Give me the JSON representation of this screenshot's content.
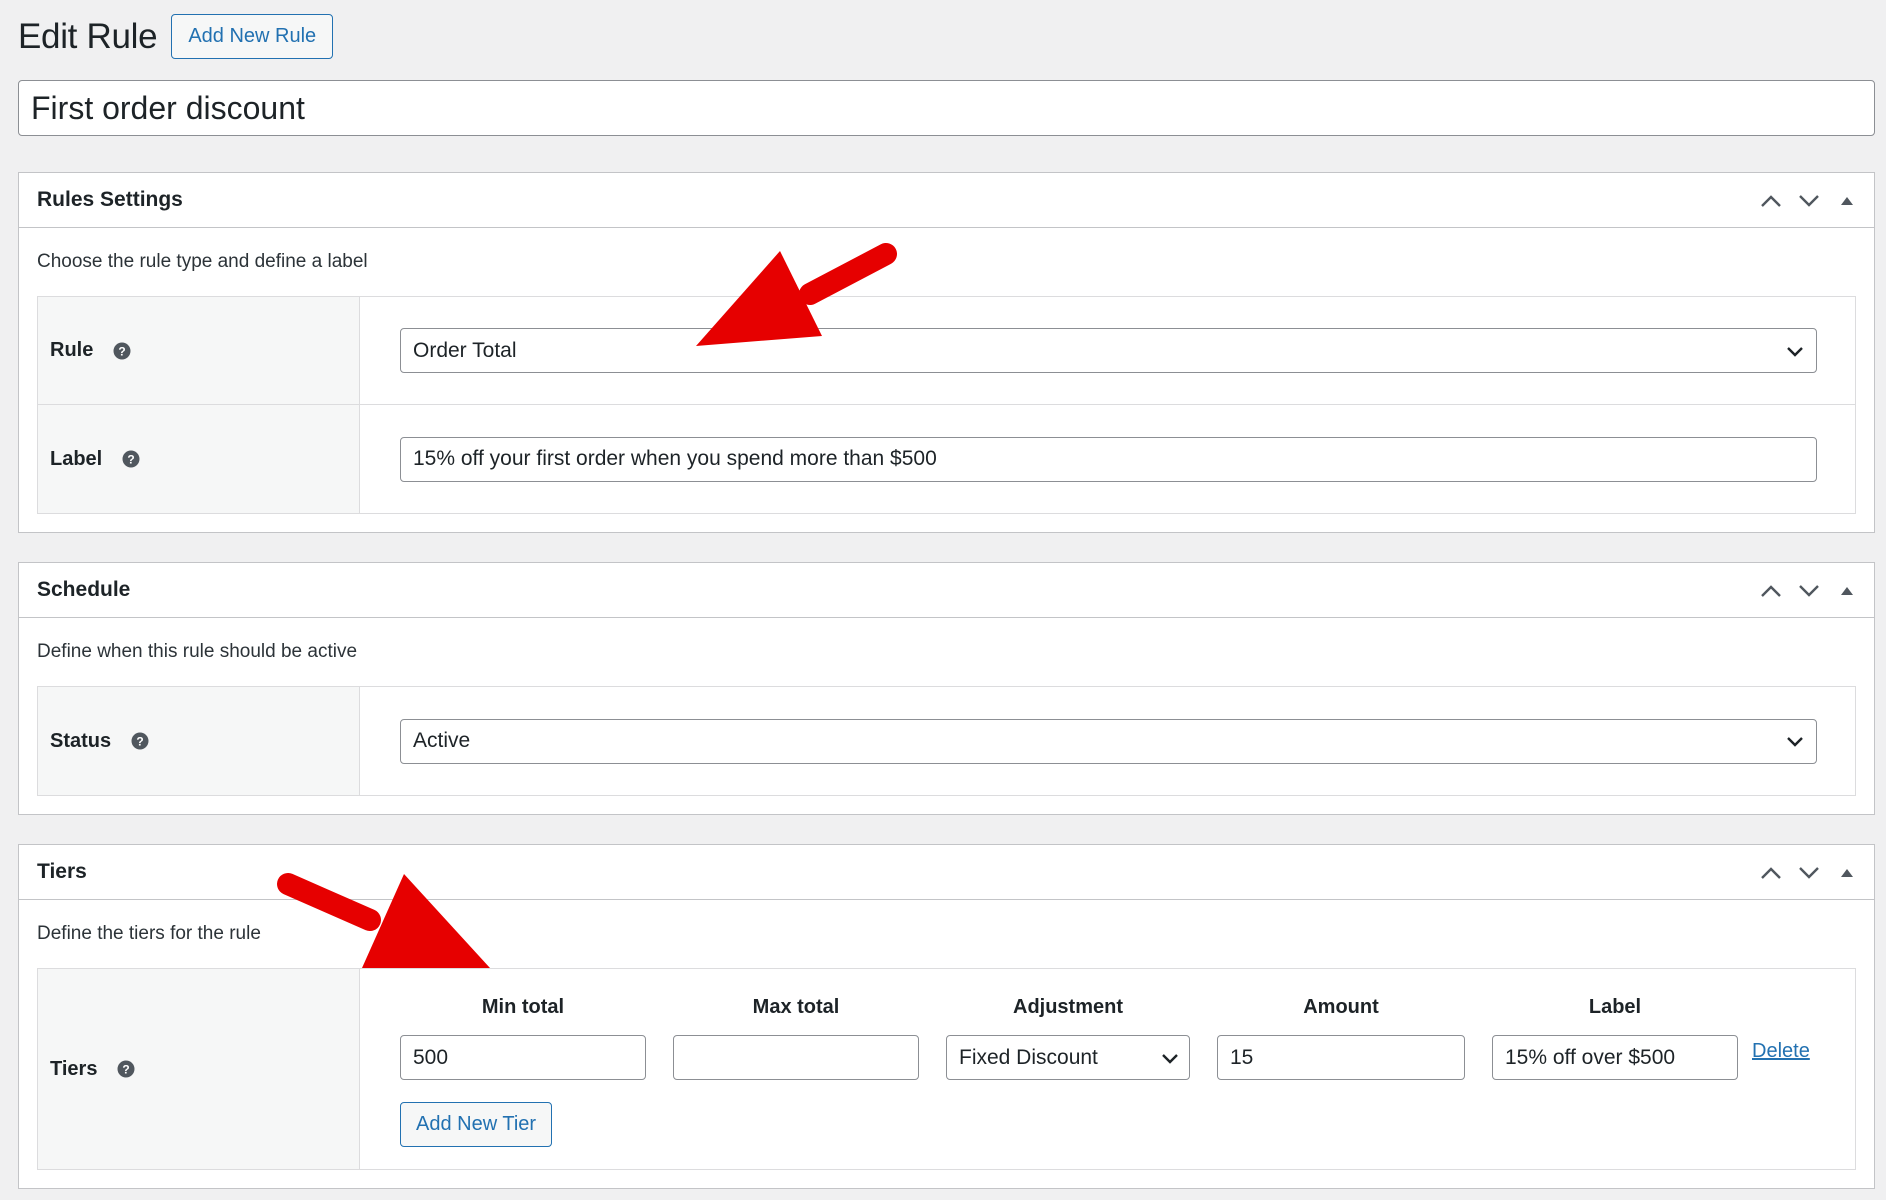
{
  "header": {
    "title": "Edit Rule",
    "add_new_rule": "Add New Rule"
  },
  "post_title": "First order discount",
  "rules_settings": {
    "title": "Rules Settings",
    "description": "Choose the rule type and define a label",
    "rule_label": "Rule",
    "rule_value": "Order Total",
    "label_label": "Label",
    "label_value": "15% off your first order when you spend more than $500"
  },
  "schedule": {
    "title": "Schedule",
    "description": "Define when this rule should be active",
    "status_label": "Status",
    "status_value": "Active"
  },
  "tiers": {
    "title": "Tiers",
    "description": "Define the tiers for the rule",
    "row_label": "Tiers",
    "columns": [
      "Min total",
      "Max total",
      "Adjustment",
      "Amount",
      "Label"
    ],
    "rows": [
      {
        "min_total": "500",
        "max_total": "",
        "adjustment": "Fixed Discount",
        "amount": "15",
        "label": "15% off over $500",
        "delete": "Delete"
      }
    ],
    "add_new_tier": "Add New Tier"
  },
  "colors": {
    "accent": "#2271b1",
    "arrow": "#e60000",
    "border": "#c3c4c7",
    "background": "#f0f0f1"
  }
}
